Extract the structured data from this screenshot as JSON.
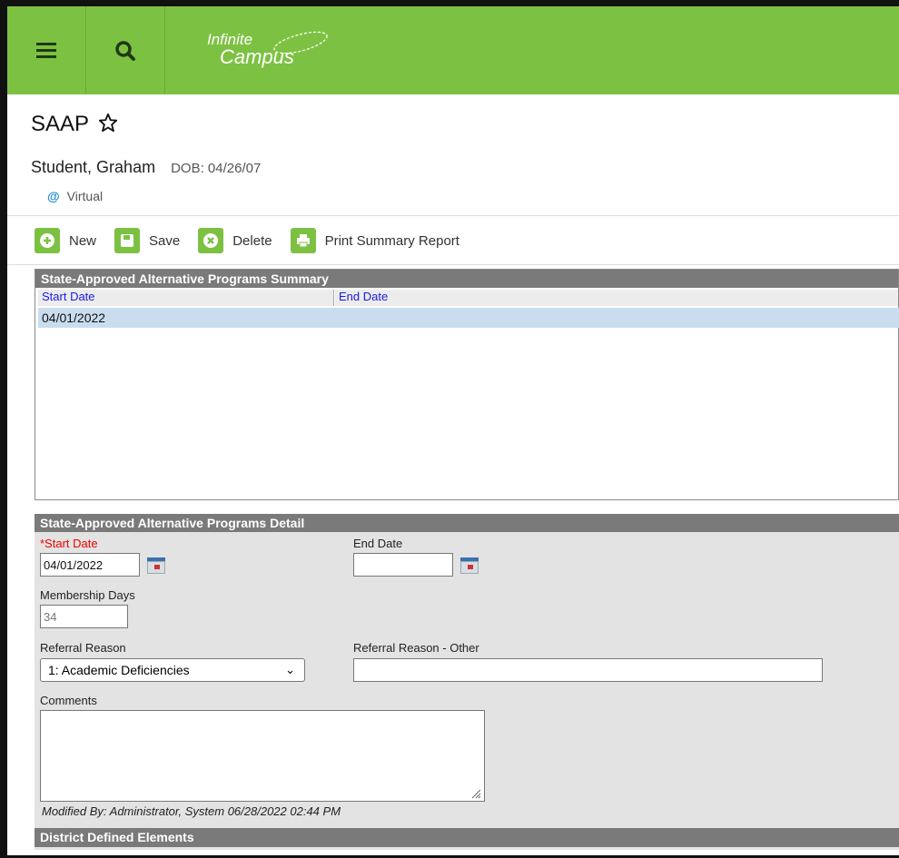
{
  "app": {
    "logo_line1": "Infinite",
    "logo_line2": "Campus"
  },
  "page": {
    "title": "SAAP"
  },
  "student": {
    "name": "Student, Graham",
    "dob": "DOB: 04/26/07",
    "tag": "Virtual"
  },
  "toolbar": {
    "new": "New",
    "save": "Save",
    "delete": "Delete",
    "print": "Print Summary Report"
  },
  "summary": {
    "title": "State-Approved Alternative Programs Summary",
    "col_start": "Start Date",
    "col_end": "End Date",
    "rows": [
      {
        "start": "04/01/2022",
        "end": ""
      }
    ]
  },
  "detail": {
    "title": "State-Approved Alternative Programs Detail",
    "start_label": "*Start Date",
    "start_value": "04/01/2022",
    "end_label": "End Date",
    "end_value": "",
    "membership_label": "Membership Days",
    "membership_value": "34",
    "referral_label": "Referral Reason",
    "referral_value": "1: Academic Deficiencies",
    "referral_other_label": "Referral Reason - Other",
    "referral_other_value": "",
    "comments_label": "Comments",
    "comments_value": "",
    "modified": "Modified By: Administrator, System 06/28/2022 02:44 PM"
  },
  "district": {
    "title": "District Defined Elements"
  },
  "colors": {
    "brand": "#7dc142",
    "panel_header": "#7a7a7a",
    "selected_row": "#c9ddef",
    "link": "#1a1ae6",
    "required": "#e00000"
  },
  "icons": [
    "menu-icon",
    "search-icon",
    "star-icon",
    "at-icon",
    "plus-icon",
    "save-icon",
    "delete-icon",
    "print-icon",
    "calendar-icon",
    "chevron-down-icon",
    "resize-grip-icon"
  ]
}
